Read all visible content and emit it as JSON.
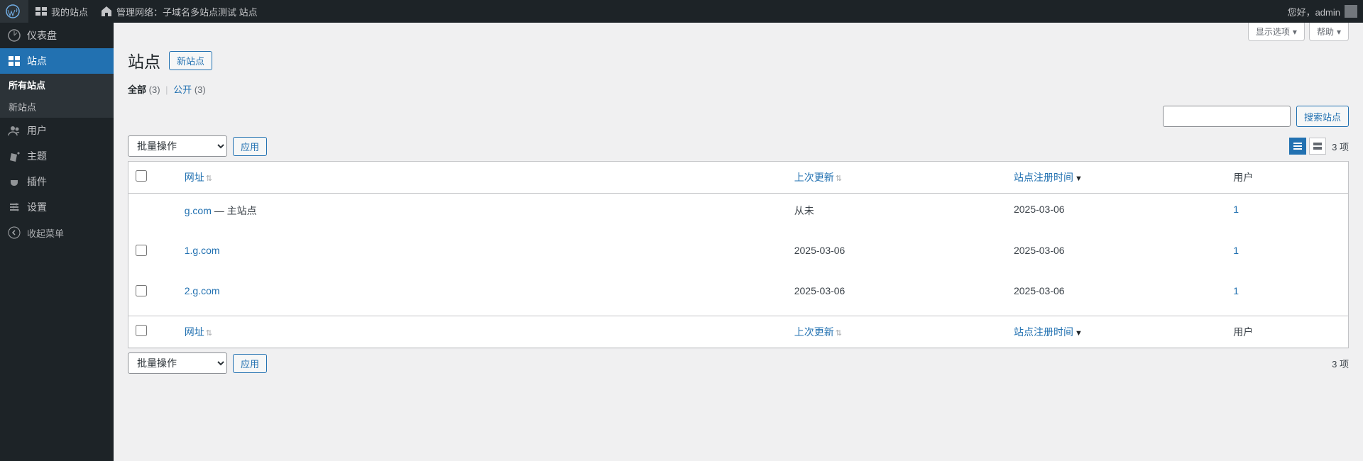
{
  "topbar": {
    "my_sites": "我的站点",
    "network_admin_prefix": "管理网络：",
    "network_name": "子域名多站点测试 站点",
    "greeting": "您好，admin"
  },
  "sidebar": {
    "dashboard": "仪表盘",
    "sites": "站点",
    "all_sites": "所有站点",
    "new_site": "新站点",
    "users": "用户",
    "themes": "主题",
    "plugins": "插件",
    "settings": "设置",
    "collapse": "收起菜单"
  },
  "screen": {
    "options": "显示选项",
    "help": "帮助"
  },
  "page": {
    "title": "站点",
    "add_new": "新站点"
  },
  "filters": {
    "all_label": "全部",
    "all_count": "(3)",
    "public_label": "公开",
    "public_count": "(3)"
  },
  "search": {
    "button": "搜索站点"
  },
  "bulk": {
    "placeholder": "批量操作",
    "apply": "应用"
  },
  "pagination": {
    "items_count": "3 项"
  },
  "columns": {
    "url": "网址",
    "last_updated": "上次更新",
    "registered": "站点注册时间",
    "users": "用户"
  },
  "rows": [
    {
      "url": "g.com",
      "primary_suffix": " — 主站点",
      "updated": "从未",
      "registered": "2025-03-06",
      "users": "1",
      "is_primary": true
    },
    {
      "url": "1.g.com",
      "primary_suffix": "",
      "updated": "2025-03-06",
      "registered": "2025-03-06",
      "users": "1",
      "is_primary": false
    },
    {
      "url": "2.g.com",
      "primary_suffix": "",
      "updated": "2025-03-06",
      "registered": "2025-03-06",
      "users": "1",
      "is_primary": false
    }
  ]
}
